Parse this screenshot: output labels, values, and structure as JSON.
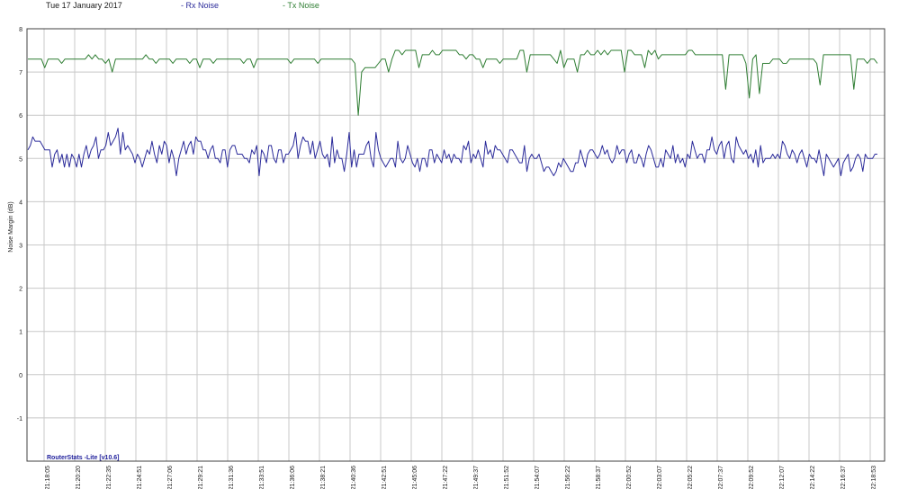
{
  "header": {
    "date": "Tue 17 January 2017",
    "rx_legend": "- Rx Noise",
    "tx_legend": "- Tx Noise"
  },
  "footer": {
    "app_label": "RouterStats -Lite [v10.6]"
  },
  "colors": {
    "rx": "#2b2b9a",
    "tx": "#2e7d32",
    "grid": "#c8c8c8",
    "frame": "#404040"
  },
  "chart_data": {
    "type": "line",
    "ylabel": "Noise Margin (dB)",
    "ylim": [
      -2,
      8
    ],
    "yticks": [
      8,
      7,
      6,
      5,
      4,
      3,
      2,
      1,
      0,
      -1
    ],
    "grid": true,
    "legend": "top",
    "xticks": [
      {
        "day": "17-Jan",
        "time": "21:18:05"
      },
      {
        "day": "17-Jan",
        "time": "21:20:20"
      },
      {
        "day": "17-Jan",
        "time": "21:22:35"
      },
      {
        "day": "17-Jan",
        "time": "21:24:51"
      },
      {
        "day": "17-Jan",
        "time": "21:27:06"
      },
      {
        "day": "17-Jan",
        "time": "21:29:21"
      },
      {
        "day": "17-Jan",
        "time": "21:31:36"
      },
      {
        "day": "17-Jan",
        "time": "21:33:51"
      },
      {
        "day": "17-Jan",
        "time": "21:36:06"
      },
      {
        "day": "17-Jan",
        "time": "21:38:21"
      },
      {
        "day": "17-Jan",
        "time": "21:40:36"
      },
      {
        "day": "17-Jan",
        "time": "21:42:51"
      },
      {
        "day": "17-Jan",
        "time": "21:45:06"
      },
      {
        "day": "17-Jan",
        "time": "21:47:22"
      },
      {
        "day": "17-Jan",
        "time": "21:49:37"
      },
      {
        "day": "17-Jan",
        "time": "21:51:52"
      },
      {
        "day": "17-Jan",
        "time": "21:54:07"
      },
      {
        "day": "17-Jan",
        "time": "21:56:22"
      },
      {
        "day": "17-Jan",
        "time": "21:58:37"
      },
      {
        "day": "17-Jan",
        "time": "22:00:52"
      },
      {
        "day": "17-Jan",
        "time": "22:03:07"
      },
      {
        "day": "17-Jan",
        "time": "22:05:22"
      },
      {
        "day": "17-Jan",
        "time": "22:07:37"
      },
      {
        "day": "17-Jan",
        "time": "22:09:52"
      },
      {
        "day": "17-Jan",
        "time": "22:12:07"
      },
      {
        "day": "17-Jan",
        "time": "22:14:22"
      },
      {
        "day": "17-Jan",
        "time": "22:16:37"
      },
      {
        "day": "17-Jan",
        "time": "22:18:53"
      }
    ],
    "series": [
      {
        "name": "Tx Noise",
        "values": [
          7.3,
          7.3,
          7.3,
          7.3,
          7.3,
          7.1,
          7.3,
          7.3,
          7.3,
          7.3,
          7.2,
          7.3,
          7.3,
          7.3,
          7.3,
          7.3,
          7.3,
          7.3,
          7.4,
          7.3,
          7.4,
          7.3,
          7.3,
          7.2,
          7.3,
          7.0,
          7.3,
          7.3,
          7.3,
          7.3,
          7.3,
          7.3,
          7.3,
          7.3,
          7.3,
          7.4,
          7.3,
          7.3,
          7.2,
          7.3,
          7.3,
          7.3,
          7.3,
          7.2,
          7.3,
          7.3,
          7.3,
          7.3,
          7.2,
          7.3,
          7.3,
          7.1,
          7.3,
          7.3,
          7.3,
          7.2,
          7.3,
          7.3,
          7.3,
          7.3,
          7.3,
          7.3,
          7.3,
          7.3,
          7.2,
          7.3,
          7.3,
          7.1,
          7.3,
          7.3,
          7.3,
          7.3,
          7.3,
          7.3,
          7.3,
          7.3,
          7.3,
          7.3,
          7.2,
          7.3,
          7.3,
          7.3,
          7.3,
          7.3,
          7.3,
          7.3,
          7.2,
          7.3,
          7.3,
          7.3,
          7.3,
          7.3,
          7.3,
          7.3,
          7.3,
          7.3,
          7.3,
          7.2,
          6.0,
          7.0,
          7.1,
          7.1,
          7.1,
          7.1,
          7.2,
          7.3,
          7.3,
          7.0,
          7.3,
          7.5,
          7.5,
          7.4,
          7.5,
          7.5,
          7.5,
          7.5,
          7.1,
          7.4,
          7.4,
          7.4,
          7.5,
          7.4,
          7.4,
          7.5,
          7.5,
          7.5,
          7.5,
          7.5,
          7.4,
          7.4,
          7.3,
          7.4,
          7.4,
          7.3,
          7.3,
          7.1,
          7.3,
          7.3,
          7.3,
          7.3,
          7.2,
          7.3,
          7.3,
          7.3,
          7.3,
          7.3,
          7.5,
          7.5,
          7.0,
          7.4,
          7.4,
          7.4,
          7.4,
          7.4,
          7.4,
          7.4,
          7.3,
          7.2,
          7.5,
          7.1,
          7.3,
          7.3,
          7.3,
          7.0,
          7.4,
          7.4,
          7.5,
          7.4,
          7.4,
          7.5,
          7.4,
          7.5,
          7.4,
          7.5,
          7.5,
          7.5,
          7.5,
          7.0,
          7.5,
          7.5,
          7.4,
          7.4,
          7.4,
          7.1,
          7.5,
          7.4,
          7.5,
          7.3,
          7.4,
          7.4,
          7.4,
          7.4,
          7.4,
          7.4,
          7.4,
          7.4,
          7.5,
          7.5,
          7.4,
          7.4,
          7.4,
          7.4,
          7.4,
          7.4,
          7.4,
          7.4,
          7.4,
          6.6,
          7.4,
          7.4,
          7.4,
          7.4,
          7.4,
          7.2,
          6.4,
          7.3,
          7.4,
          6.5,
          7.2,
          7.2,
          7.2,
          7.3,
          7.3,
          7.3,
          7.2,
          7.2,
          7.3,
          7.3,
          7.3,
          7.3,
          7.3,
          7.3,
          7.3,
          7.3,
          7.2,
          6.7,
          7.4,
          7.4,
          7.4,
          7.4,
          7.4,
          7.4,
          7.4,
          7.4,
          7.4,
          6.6,
          7.3,
          7.3,
          7.3,
          7.2,
          7.3,
          7.3,
          7.2
        ]
      },
      {
        "name": "Rx Noise",
        "values": [
          5.2,
          5.3,
          5.5,
          5.4,
          5.4,
          5.4,
          5.3,
          5.2,
          5.2,
          5.2,
          4.8,
          5.1,
          5.2,
          4.9,
          5.1,
          4.8,
          5.1,
          4.8,
          5.1,
          5.0,
          4.8,
          5.1,
          4.8,
          5.1,
          5.3,
          5.0,
          5.2,
          5.3,
          5.5,
          5.0,
          5.2,
          5.2,
          5.3,
          5.6,
          5.3,
          5.4,
          5.5,
          5.7,
          5.1,
          5.6,
          5.2,
          5.3,
          5.2,
          5.1,
          4.9,
          5.1,
          5.0,
          4.8,
          5.0,
          5.2,
          5.1,
          5.4,
          5.1,
          4.9,
          5.3,
          5.1,
          5.4,
          5.3,
          4.9,
          5.2,
          5.0,
          4.6,
          5.0,
          5.2,
          5.4,
          5.1,
          5.3,
          5.4,
          5.1,
          5.5,
          5.4,
          5.4,
          5.2,
          5.2,
          5.0,
          5.2,
          5.3,
          5.0,
          5.0,
          4.9,
          5.2,
          5.2,
          4.8,
          5.2,
          5.3,
          5.3,
          5.1,
          5.1,
          5.1,
          5.0,
          5.0,
          4.9,
          5.2,
          5.1,
          5.3,
          4.6,
          5.2,
          5.1,
          4.9,
          5.3,
          5.3,
          5.0,
          4.9,
          5.2,
          5.2,
          4.9,
          5.1,
          5.1,
          5.2,
          5.3,
          5.6,
          5.0,
          5.3,
          5.5,
          5.4,
          5.4,
          5.1,
          5.4,
          5.0,
          5.2,
          5.4,
          5.1,
          5.0,
          5.1,
          4.8,
          5.5,
          4.9,
          5.2,
          5.0,
          5.0,
          4.7,
          5.1,
          5.6,
          4.8,
          5.2,
          4.8,
          5.1,
          5.1,
          5.1,
          5.3,
          5.4,
          5.0,
          4.8,
          5.6,
          5.2,
          5.0,
          4.9,
          4.8,
          4.9,
          5.0,
          5.0,
          4.8,
          5.4,
          5.0,
          4.9,
          5.0,
          5.3,
          5.1,
          4.9,
          4.8,
          5.0,
          4.7,
          5.0,
          5.0,
          4.8,
          5.2,
          5.2,
          4.9,
          5.1,
          5.0,
          4.9,
          5.2,
          5.0,
          5.1,
          4.9,
          5.1,
          5.0,
          5.0,
          4.9,
          5.3,
          5.2,
          5.4,
          4.9,
          5.1,
          5.0,
          5.2,
          5.0,
          4.8,
          5.4,
          5.1,
          5.2,
          5.0,
          5.3,
          5.2,
          5.2,
          5.1,
          5.0,
          4.9,
          5.2,
          5.2,
          5.1,
          5.0,
          4.9,
          4.9,
          5.3,
          4.7,
          5.0,
          5.1,
          5.0,
          5.0,
          5.1,
          4.9,
          4.7,
          4.8,
          4.8,
          4.7,
          4.6,
          4.7,
          4.9,
          4.8,
          5.0,
          4.9,
          4.8,
          4.7,
          4.7,
          4.9,
          4.9,
          5.2,
          5.0,
          4.8,
          5.1,
          5.2,
          5.2,
          5.1,
          5.0,
          5.1,
          5.3,
          5.1,
          5.2,
          5.0,
          4.9,
          5.0,
          5.3,
          5.1,
          5.2,
          5.2,
          4.9,
          5.1,
          5.2,
          4.9,
          4.9,
          5.1,
          5.0,
          4.8,
          5.1,
          5.3,
          5.2,
          5.0,
          4.8,
          4.8,
          5.0,
          4.8,
          5.2,
          5.1,
          5.0,
          5.3,
          4.9,
          5.1,
          4.9,
          5.0,
          4.8,
          5.1,
          5.0,
          5.4,
          5.2,
          5.0,
          5.1,
          5.1,
          4.9,
          5.2,
          5.2,
          5.5,
          5.2,
          5.1,
          5.3,
          5.4,
          5.0,
          5.3,
          5.4,
          5.0,
          4.9,
          5.5,
          5.3,
          5.2,
          5.1,
          5.2,
          5.0,
          5.1,
          4.9,
          5.2,
          4.8,
          5.3,
          4.9,
          5.0,
          5.0,
          5.0,
          5.1,
          5.0,
          5.1,
          5.0,
          5.4,
          5.3,
          5.1,
          5.0,
          5.2,
          5.1,
          4.9,
          5.1,
          5.2,
          5.0,
          4.8,
          5.1,
          5.0,
          5.0,
          4.9,
          5.2,
          4.9,
          4.6,
          5.1,
          5.0,
          4.9,
          4.8,
          4.9,
          5.0,
          4.6,
          4.9,
          5.0,
          5.1,
          4.7,
          4.8,
          5.0,
          5.1,
          5.0,
          4.7,
          5.1,
          5.0,
          5.0,
          5.0,
          5.1,
          5.1
        ]
      }
    ]
  }
}
